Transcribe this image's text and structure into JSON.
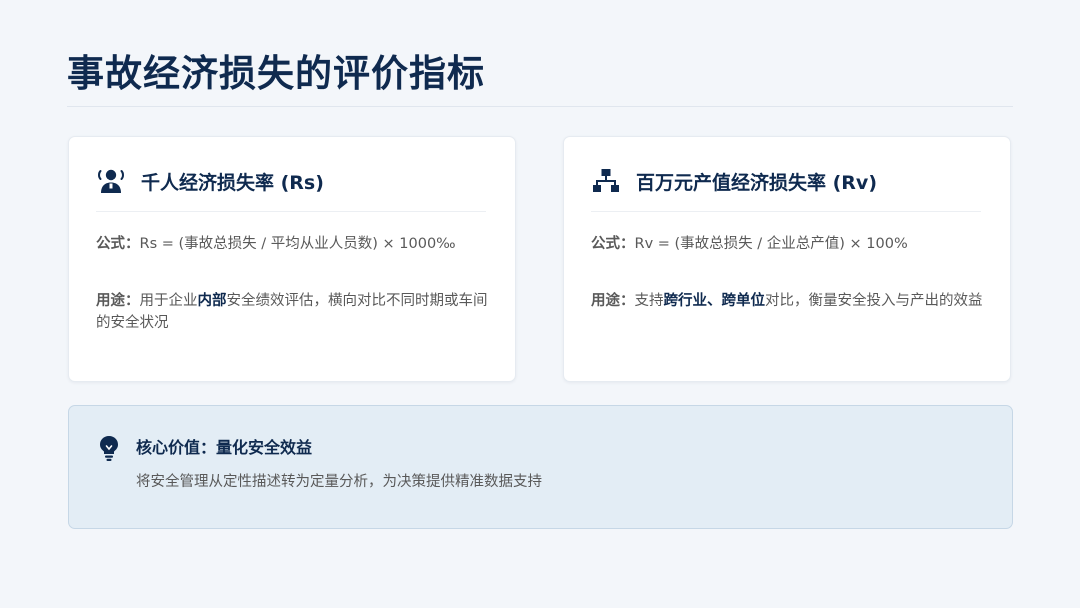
{
  "page": {
    "title": "事故经济损失的评价指标"
  },
  "cards": [
    {
      "icon": "people-icon",
      "title": "千人经济损失率 (Rs)",
      "formula_label": "公式：",
      "formula": "Rs = (事故总损失 / 平均从业人员数) × 1000‰",
      "usage_label": "用途：",
      "usage_before": "用于企业",
      "usage_highlight": "内部",
      "usage_after": "安全绩效评估，横向对比不同时期或车间的安全状况"
    },
    {
      "icon": "org-chart-icon",
      "title": "百万元产值经济损失率 (Rv)",
      "formula_label": "公式：",
      "formula": "Rv = (事故总损失 / 企业总产值) × 100%",
      "usage_label": "用途：",
      "usage_before": "支持",
      "usage_highlight": "跨行业、跨单位",
      "usage_after": "对比，衡量安全投入与产出的效益"
    }
  ],
  "callout": {
    "icon": "lightbulb-icon",
    "title": "核心价值：量化安全效益",
    "text": "将安全管理从定性描述转为定量分析，为决策提供精准数据支持"
  },
  "colors": {
    "background": "#f3f6fa",
    "accent_navy": "#0f2a4f",
    "body_text": "#595959",
    "callout_bg": "#e3edf5",
    "callout_border": "#c6d7e6"
  }
}
